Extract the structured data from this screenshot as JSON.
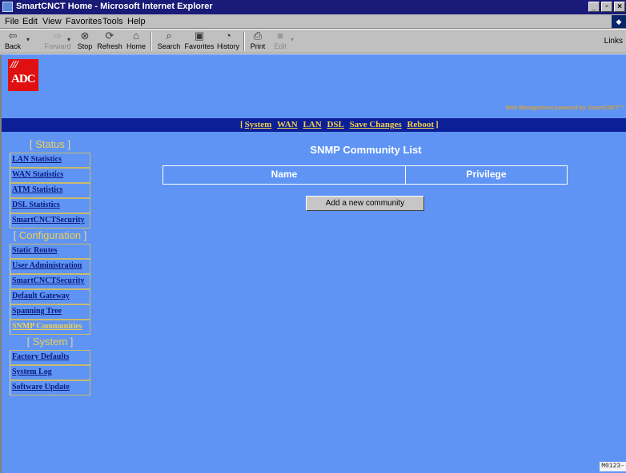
{
  "window": {
    "title": "SmartCNCT Home - Microsoft Internet Explorer",
    "controls": [
      "_",
      "▫",
      "×"
    ]
  },
  "menu": {
    "items": [
      "File",
      "Edit",
      "View",
      "Favorites",
      "Tools",
      "Help"
    ]
  },
  "toolbar": {
    "back": "Back",
    "forward": "Forward",
    "stop": "Stop",
    "refresh": "Refresh",
    "home": "Home",
    "search": "Search",
    "favorites": "Favorites",
    "history": "History",
    "print": "Print",
    "edit": "Edit",
    "links": "Links"
  },
  "header": {
    "logo_text": "ADC",
    "powered_by": "Web Management powered by SmartCNCT™"
  },
  "nav": {
    "links": [
      "System",
      "WAN",
      "LAN",
      "DSL",
      "Save Changes",
      "Reboot"
    ]
  },
  "sidebar": {
    "status_title": "Status",
    "status_items": [
      "LAN Statistics",
      "WAN Statistics",
      "ATM Statistics",
      "DSL Statistics",
      "SmartCNCTSecurity"
    ],
    "config_title": "Configuration",
    "config_items": [
      "Static Routes",
      "User Administration",
      "SmartCNCTSecurity",
      "Default Gateway",
      "Spanning Tree",
      "SNMP Communities"
    ],
    "system_title": "System",
    "system_items": [
      "Factory Defaults",
      "System Log",
      "Software Update"
    ]
  },
  "main": {
    "title": "SNMP Community List",
    "columns": [
      "Name",
      "Privilege"
    ],
    "add_button": "Add a new community"
  },
  "figure_id": "M0123-"
}
